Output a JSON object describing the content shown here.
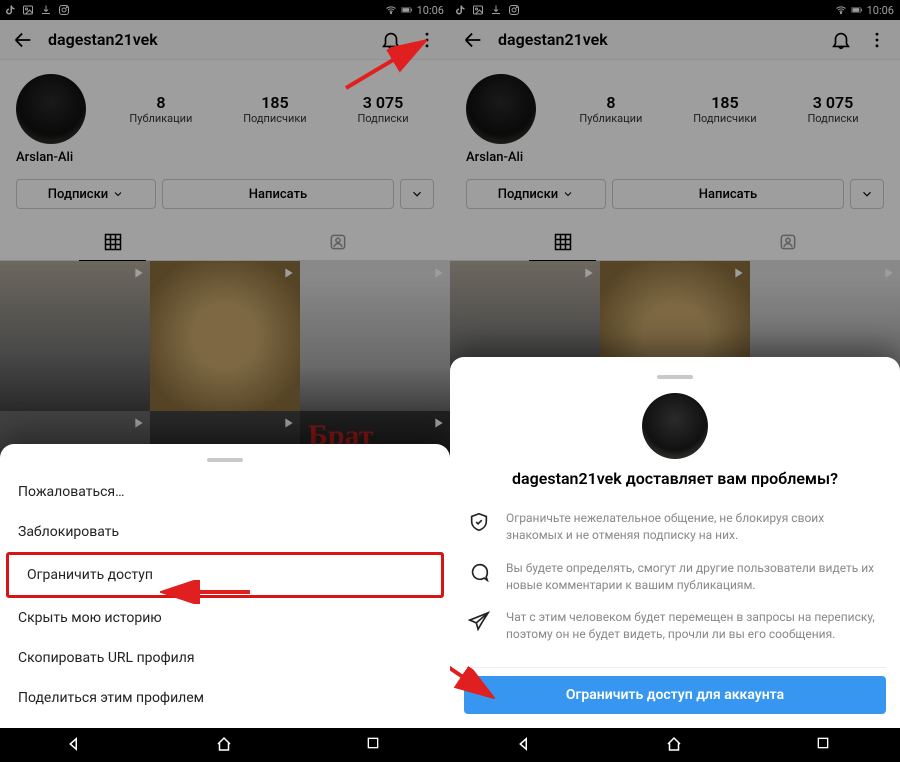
{
  "status": {
    "time": "10:06"
  },
  "profile": {
    "username": "dagestan21vek",
    "display_name": "Arslan-Ali",
    "stats": {
      "posts": {
        "value": "8",
        "label": "Публикации"
      },
      "followers": {
        "value": "185",
        "label": "Подписчики"
      },
      "following": {
        "value": "3 075",
        "label": "Подписки"
      }
    },
    "buttons": {
      "follow": "Подписки",
      "message": "Написать"
    },
    "post6_text": "Брат"
  },
  "menu": {
    "items": [
      "Пожаловаться…",
      "Заблокировать",
      "Ограничить доступ",
      "Скрыть мою историю",
      "Скопировать URL профиля",
      "Поделиться этим профилем"
    ],
    "highlight_index": 2
  },
  "confirm": {
    "title": "dagestan21vek доставляет вам проблемы?",
    "rows": [
      "Ограничьте нежелательное общение, не блокируя своих знакомых и не отменяя подписку на них.",
      "Вы будете определять, смогут ли другие пользователи видеть их новые комментарии к вашим публикациям.",
      "Чат с этим человеком будет перемещен в запросы на переписку, поэтому он не будет видеть, прочли ли вы его сообщения."
    ],
    "cta": "Ограничить доступ для аккаунта"
  }
}
